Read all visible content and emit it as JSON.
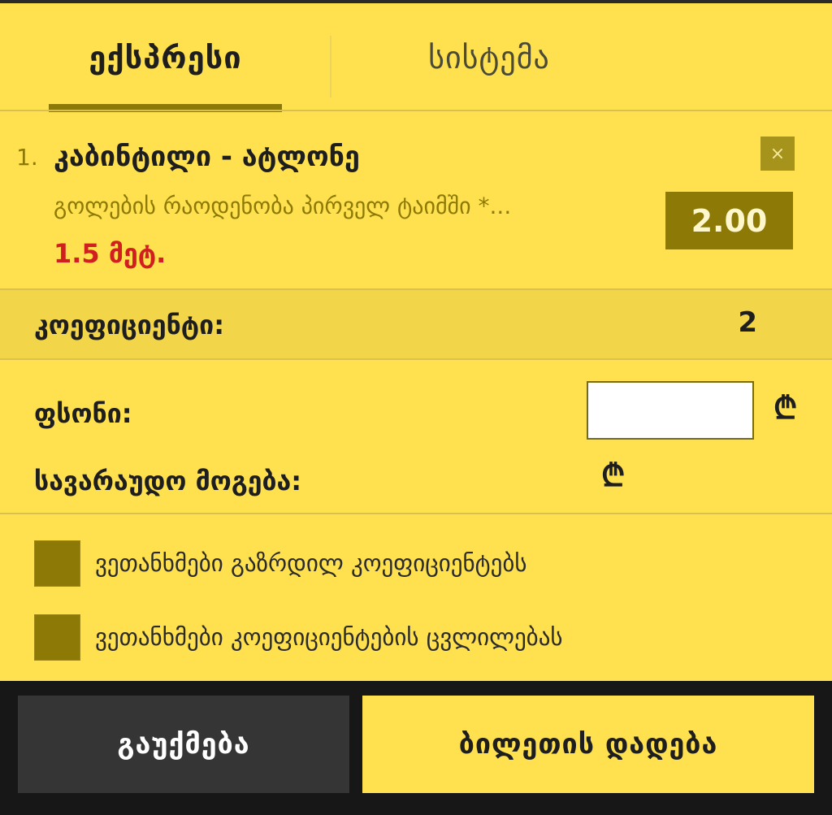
{
  "tabs": {
    "active_label": "ექსპრესი",
    "inactive_label": "სისტემა"
  },
  "bet": {
    "index": "1.",
    "title": "კაბინტილი - ატლონე",
    "market": "გოლების რაოდენობა პირველ ტაიმში *...",
    "outcome": "1.5 მეტ.",
    "odds": "2.00",
    "remove_symbol": "×"
  },
  "coefficient": {
    "label": "კოეფიციენტი:",
    "value": "2"
  },
  "stake": {
    "label": "ფსონი:",
    "value": "",
    "currency_symbol": "₾"
  },
  "potential_win": {
    "label": "სავარაუდო მოგება:",
    "currency_symbol": "₾"
  },
  "options": [
    {
      "label": "ვეთანხმები გაზრდილ კოეფიციენტებს",
      "checked": false
    },
    {
      "label": "ვეთანხმები კოეფიციენტების ცვლილებას",
      "checked": false
    }
  ],
  "actions": {
    "cancel_label": "გაუქმება",
    "place_label": "ბილეთის დადება"
  },
  "colors": {
    "background": "#ffe04f",
    "accent": "#8d7a06",
    "outcome_red": "#d11f1f",
    "dark_button": "#353535"
  }
}
